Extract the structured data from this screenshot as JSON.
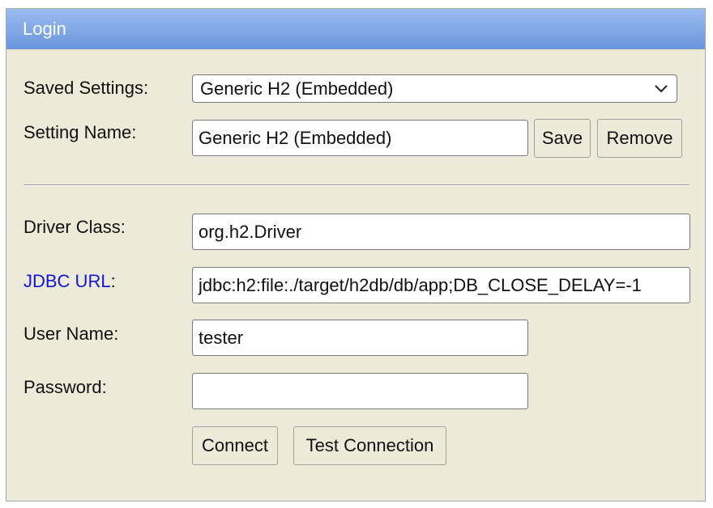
{
  "window": {
    "title": "Login"
  },
  "saved_settings": {
    "label": "Saved Settings:",
    "selected": "Generic H2 (Embedded)",
    "icon": "chevron-down-icon"
  },
  "setting_name": {
    "label": "Setting Name:",
    "value": "Generic H2 (Embedded)",
    "save_label": "Save",
    "remove_label": "Remove"
  },
  "driver_class": {
    "label": "Driver Class:",
    "value": "org.h2.Driver"
  },
  "jdbc_url": {
    "link_label": "JDBC URL",
    "suffix": ":",
    "value": "jdbc:h2:file:./target/h2db/db/app;DB_CLOSE_DELAY=-1"
  },
  "user_name": {
    "label": "User Name:",
    "value": "tester"
  },
  "password": {
    "label": "Password:",
    "value": ""
  },
  "actions": {
    "connect_label": "Connect",
    "test_label": "Test Connection"
  },
  "colors": {
    "title_bar_top": "#9cbcf0",
    "title_bar_bottom": "#6a96dd",
    "panel_background": "#ecead9",
    "link": "#1515d6"
  }
}
